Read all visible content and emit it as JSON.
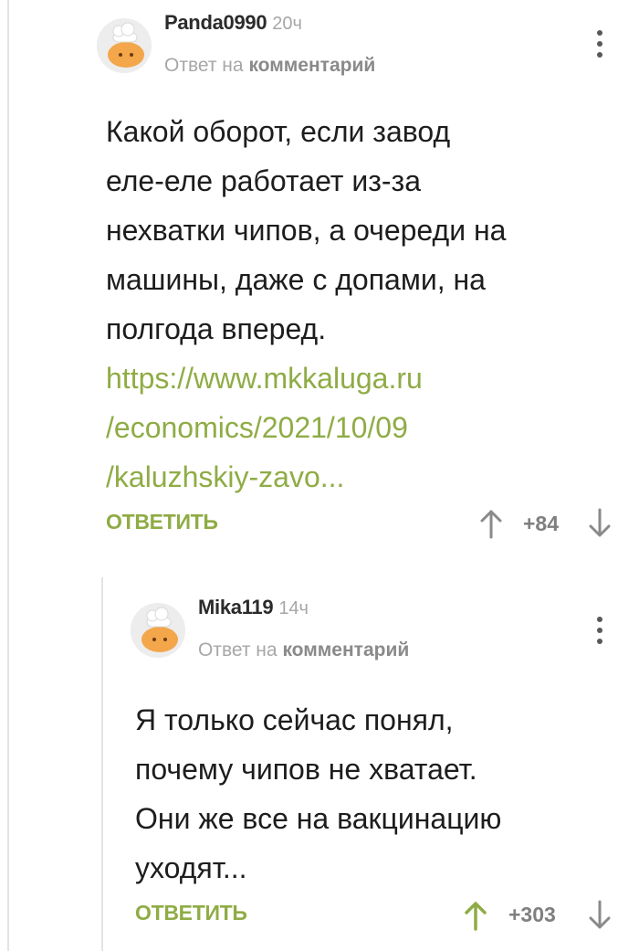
{
  "comments": [
    {
      "username": "Panda0990",
      "time": "20ч",
      "reply_prefix": "Ответ на",
      "reply_target": "комментарий",
      "text_lines": [
        "Какой оборот, если завод",
        "еле-еле работает из-за",
        "нехватки чипов, а очереди на",
        "машины, даже с допами, на",
        "полгода вперед."
      ],
      "link_lines": [
        "https://www.mkkaluga.ru",
        "/economics/2021/10/09",
        "/kaluzhskiy-zavo..."
      ],
      "reply_label": "ОТВЕТИТЬ",
      "score": "+84",
      "up_icon": "arrow-up-icon",
      "down_icon": "arrow-down-icon",
      "up_color": "#8a8a8a"
    },
    {
      "username": "Mika119",
      "time": "14ч",
      "reply_prefix": "Ответ на",
      "reply_target": "комментарий",
      "text_lines": [
        "Я только сейчас понял,",
        "почему чипов не хватает.",
        "Они же все на вакцинацию",
        "уходят..."
      ],
      "reply_label": "ОТВЕТИТЬ",
      "score": "+303",
      "up_icon": "arrow-up-icon",
      "down_icon": "arrow-down-icon",
      "up_color": "#8fac45"
    }
  ],
  "colors": {
    "accent_green": "#8fac45",
    "muted_gray": "#a7a7a7",
    "text": "#1d1d1d",
    "thread_line": "#e3e3e3"
  }
}
